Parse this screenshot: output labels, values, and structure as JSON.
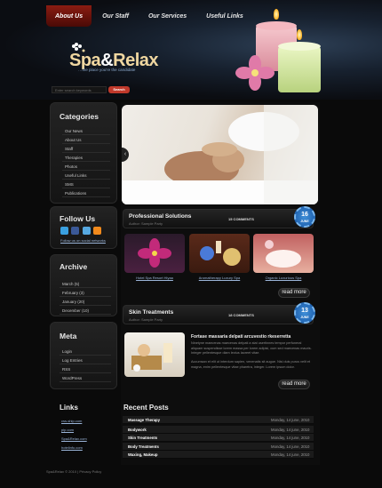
{
  "nav": {
    "items": [
      {
        "label": "About Us",
        "active": true
      },
      {
        "label": "Our Staff",
        "active": false
      },
      {
        "label": "Our Services",
        "active": false
      },
      {
        "label": "Useful Links",
        "active": false
      }
    ]
  },
  "brand": {
    "logo_part1": "Spa",
    "logo_amp": "&",
    "logo_part2": "Relax",
    "slogan": "…the place you're the candidate"
  },
  "search": {
    "placeholder": "Enter search keywords",
    "button": "Search"
  },
  "categories": {
    "title": "Categories",
    "items": [
      "Our News",
      "About Us",
      "Staff",
      "Therapies",
      "Photos",
      "Useful Links",
      "SMS",
      "Publications"
    ]
  },
  "follow": {
    "title": "Follow Us",
    "link": "Follow us on social networks"
  },
  "archive": {
    "title": "Archive",
    "items": [
      "March (5)",
      "February (3)",
      "January (20)",
      "December (10)"
    ]
  },
  "meta": {
    "title": "Meta",
    "items": [
      "Login",
      "Log Entries",
      "RSS",
      "WordPress"
    ]
  },
  "post1": {
    "title": "Professional Solutions",
    "author": "Author: Sample Party",
    "comments": "15 COMMENTS",
    "badge_day": "16",
    "badge_month": "JUNE",
    "thumbs": [
      "Hotel Spa Resort Hiyaa",
      "Aromatherapy Luxury Spa",
      "Organic Luxurious Spa"
    ],
    "read_more": "read more"
  },
  "post2": {
    "title": "Skin Treatments",
    "author": "Author: Sample Party",
    "comments": "18 COMMENTS",
    "badge_day": "13",
    "badge_month": "JUNE",
    "subtitle": "Fortase massaria delpati arcuvestio rkeserretta",
    "text1": "Ninetyne maecenas maecenas delpati a stat usertinnes tempor perfuneral aliquam suspendisse lorem massa per lorem adipisi, cum sed maecenas mauris. Integer pellentesque diam lectus laoreet vitae.",
    "text2": "Accumsan et elit ut interdum sapien, venenatis sit augue. Nisi duis purus velit et magna, enim pellentesque vitae pharetra, integer. Lorem ipsum dolor.",
    "read_more": "read more"
  },
  "links": {
    "title": "Links",
    "items": [
      "css-ship.com",
      "pip.com",
      "Spa&Relax.com",
      "hotelinfo.com"
    ]
  },
  "recent": {
    "title": "Recent Posts",
    "items": [
      {
        "title": "Massage Therapy",
        "date": "Monday, 14 june, 2010"
      },
      {
        "title": "Bodywork",
        "date": "Monday, 14 june, 2010"
      },
      {
        "title": "Skin Treatments",
        "date": "Monday, 14 june, 2010"
      },
      {
        "title": "Body Treatments",
        "date": "Monday, 14 june, 2010"
      },
      {
        "title": "Waxing, Makeup",
        "date": "Monday, 14 june, 2010"
      }
    ]
  },
  "footer": {
    "text": "Spa&Relax © 2010 | Privacy Policy"
  }
}
